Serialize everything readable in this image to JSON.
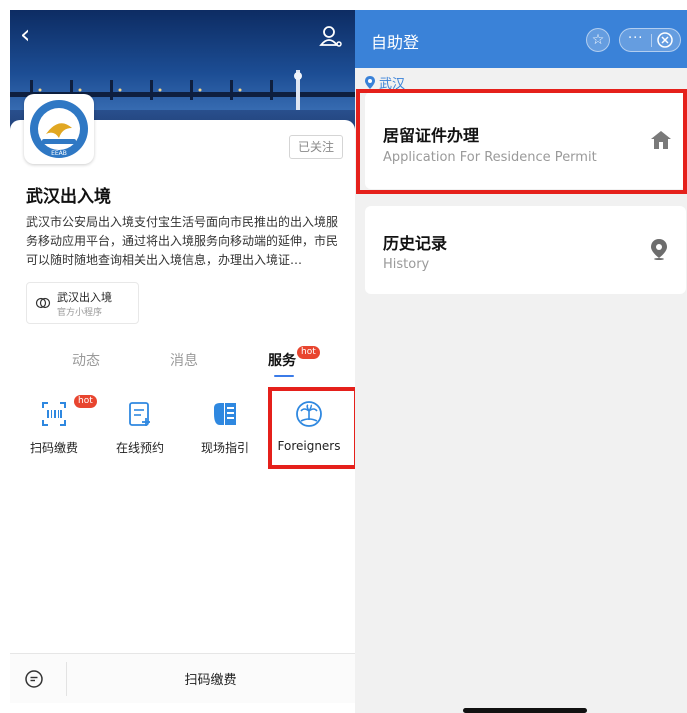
{
  "left_panel": {
    "account": {
      "follow_label": "已关注",
      "name": "武汉出入境",
      "description": "武汉市公安局出入境支付宝生活号面向市民推出的出入境服务移动应用平台，通过将出入境服务向移动端的延伸，市民可以随时随地查询相关出入境信息，办理出入境证…",
      "logo_text": "EEAB"
    },
    "mini_program": {
      "name": "武汉出入境",
      "subtitle": "官方小程序"
    },
    "tabs": [
      {
        "label": "动态",
        "active": false
      },
      {
        "label": "消息",
        "active": false
      },
      {
        "label": "服务",
        "active": true,
        "badge": "hot"
      }
    ],
    "services": [
      {
        "label": "扫码缴费",
        "icon": "scan-barcode-icon",
        "badge": "hot"
      },
      {
        "label": "在线预约",
        "icon": "edit-document-icon"
      },
      {
        "label": "现场指引",
        "icon": "building-guide-icon"
      },
      {
        "label": "Foreigners",
        "icon": "palm-tree-globe-icon"
      }
    ],
    "bottom_bar": {
      "icon": "chat-bubble-icon",
      "label": "扫码缴费"
    }
  },
  "right_panel": {
    "header": {
      "title": "自助登",
      "star_icon": "☆",
      "more_icon": "···"
    },
    "location": "武汉",
    "menu": [
      {
        "title": "居留证件办理",
        "subtitle": "Application For Residence Permit",
        "icon": "home-icon"
      },
      {
        "title": "历史记录",
        "subtitle": "History",
        "icon": "location-pin-icon"
      }
    ]
  },
  "colors": {
    "accent_blue": "#3a82d8",
    "highlight_red": "#e5201b",
    "hot_badge": "#e8452f",
    "tab_underline": "#3b7be8"
  }
}
